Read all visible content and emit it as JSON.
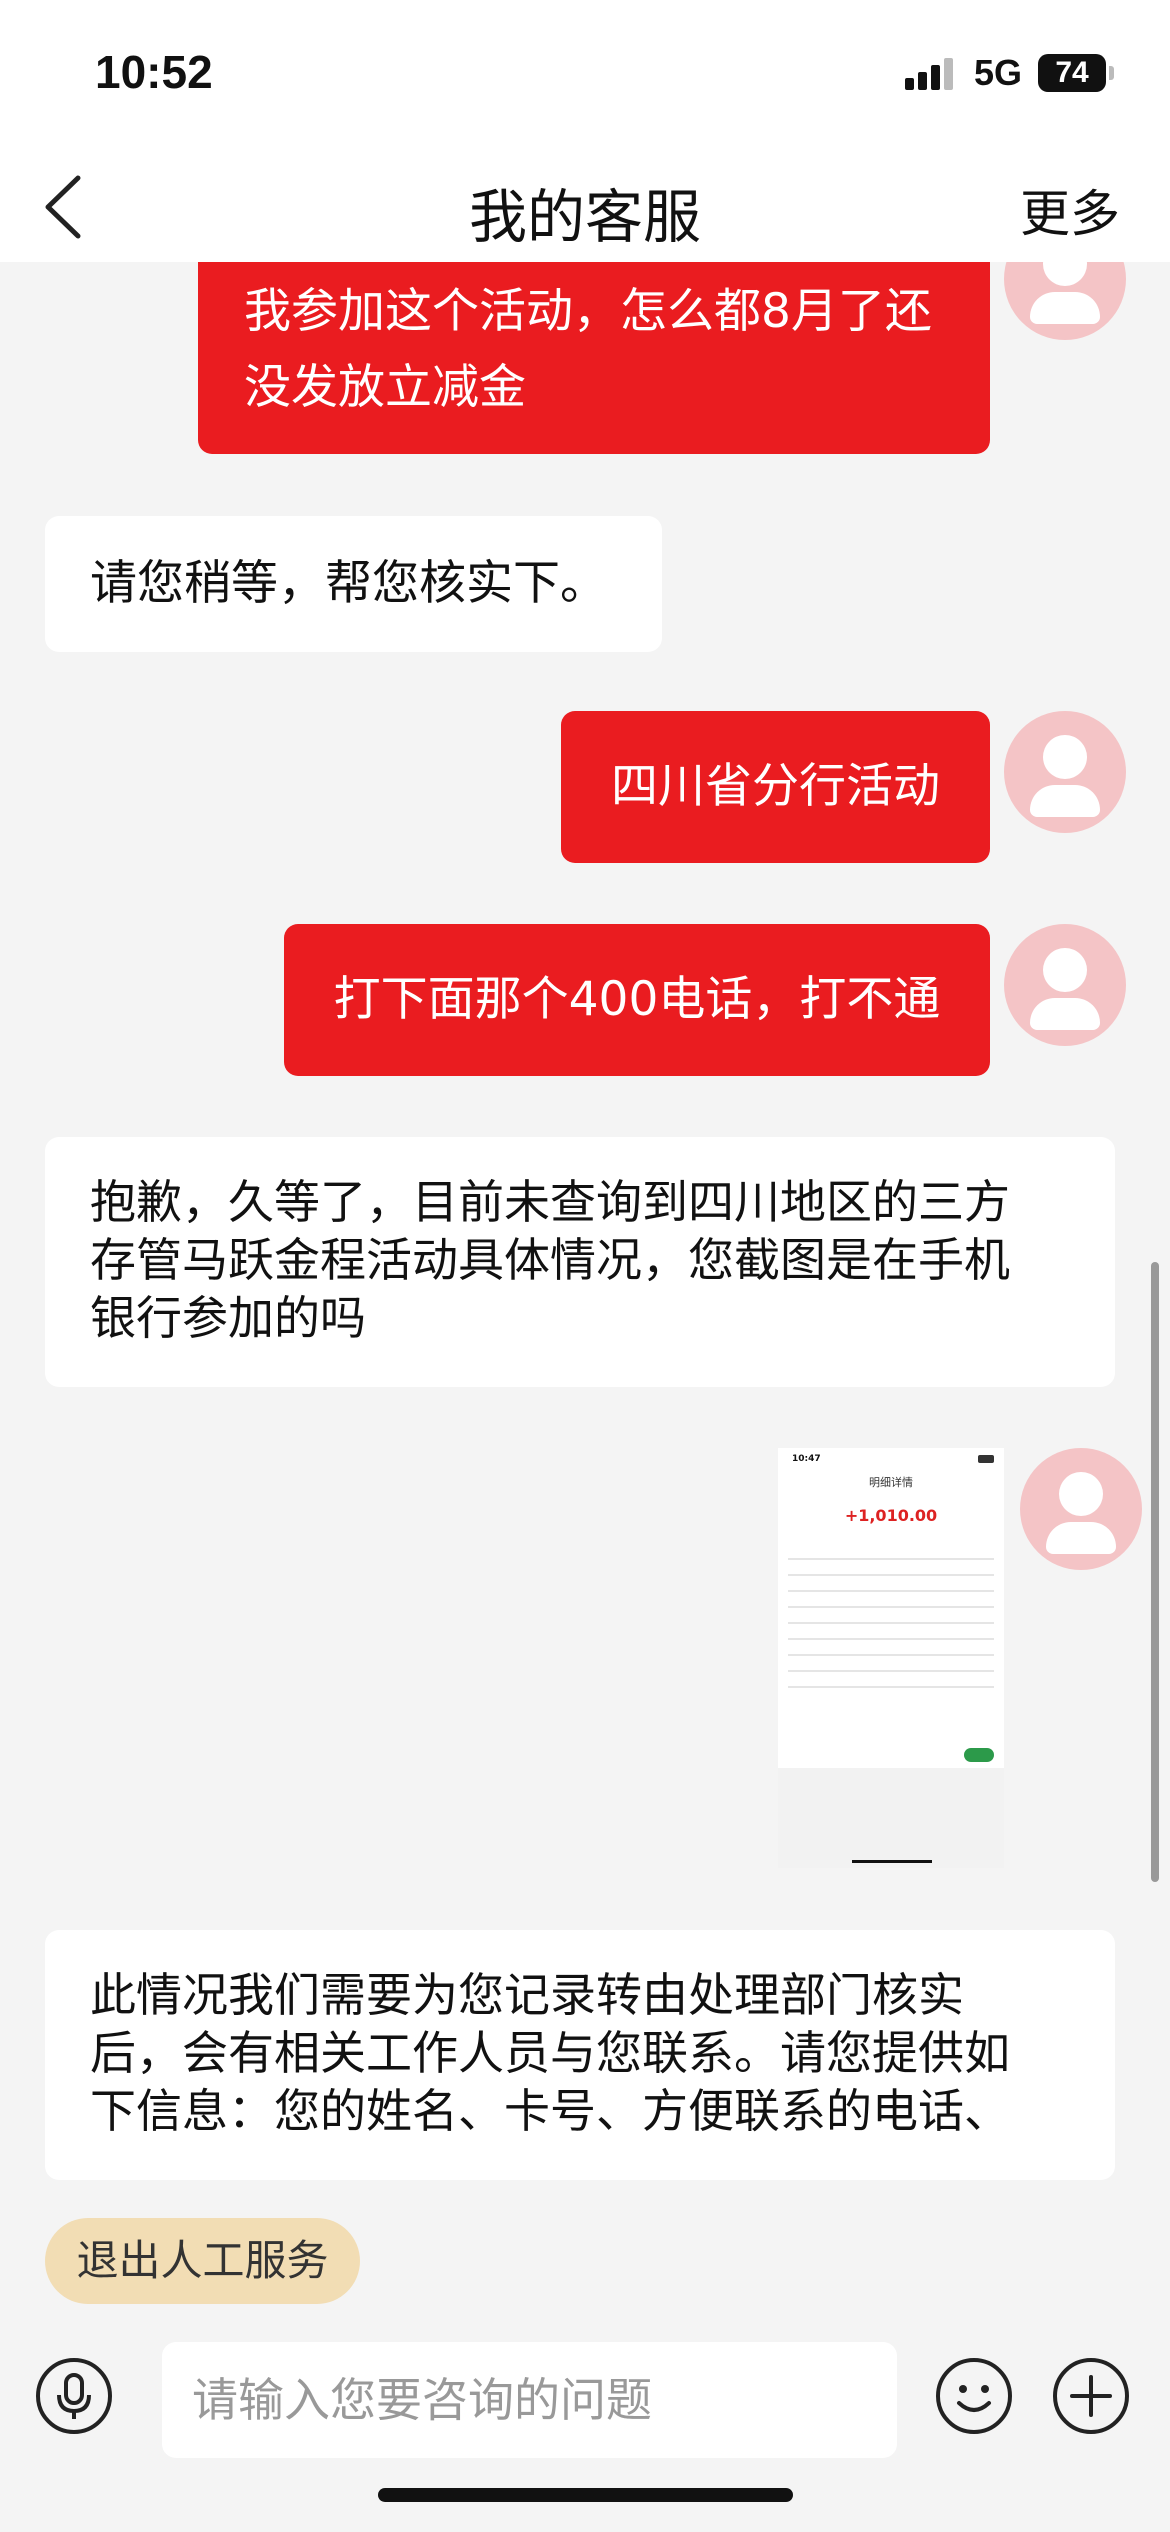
{
  "status": {
    "time": "10:52",
    "network": "5G",
    "battery": "74"
  },
  "nav": {
    "title": "我的客服",
    "more": "更多"
  },
  "messages": {
    "m1": {
      "line1": "我参加这个活动，怎么都8月了还",
      "line2": "没发放立减金"
    },
    "m2": "请您稍等，帮您核实下。",
    "m3": "四川省分行活动",
    "m4": "打下面那个400电话，打不通",
    "m5": {
      "line1": "抱歉，久等了，目前未查询到四川地区的三方",
      "line2": "存管马跃金程活动具体情况，您截图是在手机",
      "line3": "银行参加的吗"
    },
    "m7": {
      "line1": "此情况我们需要为您记录转由处理部门核实",
      "line2": "后，会有相关工作人员与您联系。请您提供如",
      "line3": "下信息：您的姓名、卡号、方便联系的电话、"
    }
  },
  "screenshot_msg": {
    "time": "10:47",
    "title": "明细详情",
    "amount": "+1,010.00"
  },
  "exit_button": "退出人工服务",
  "input": {
    "placeholder": "请输入您要咨询的问题"
  },
  "icons": [
    "back-arrow-icon",
    "signal-icon",
    "battery-icon",
    "user-avatar-icon",
    "microphone-icon",
    "emoji-icon",
    "plus-icon"
  ]
}
